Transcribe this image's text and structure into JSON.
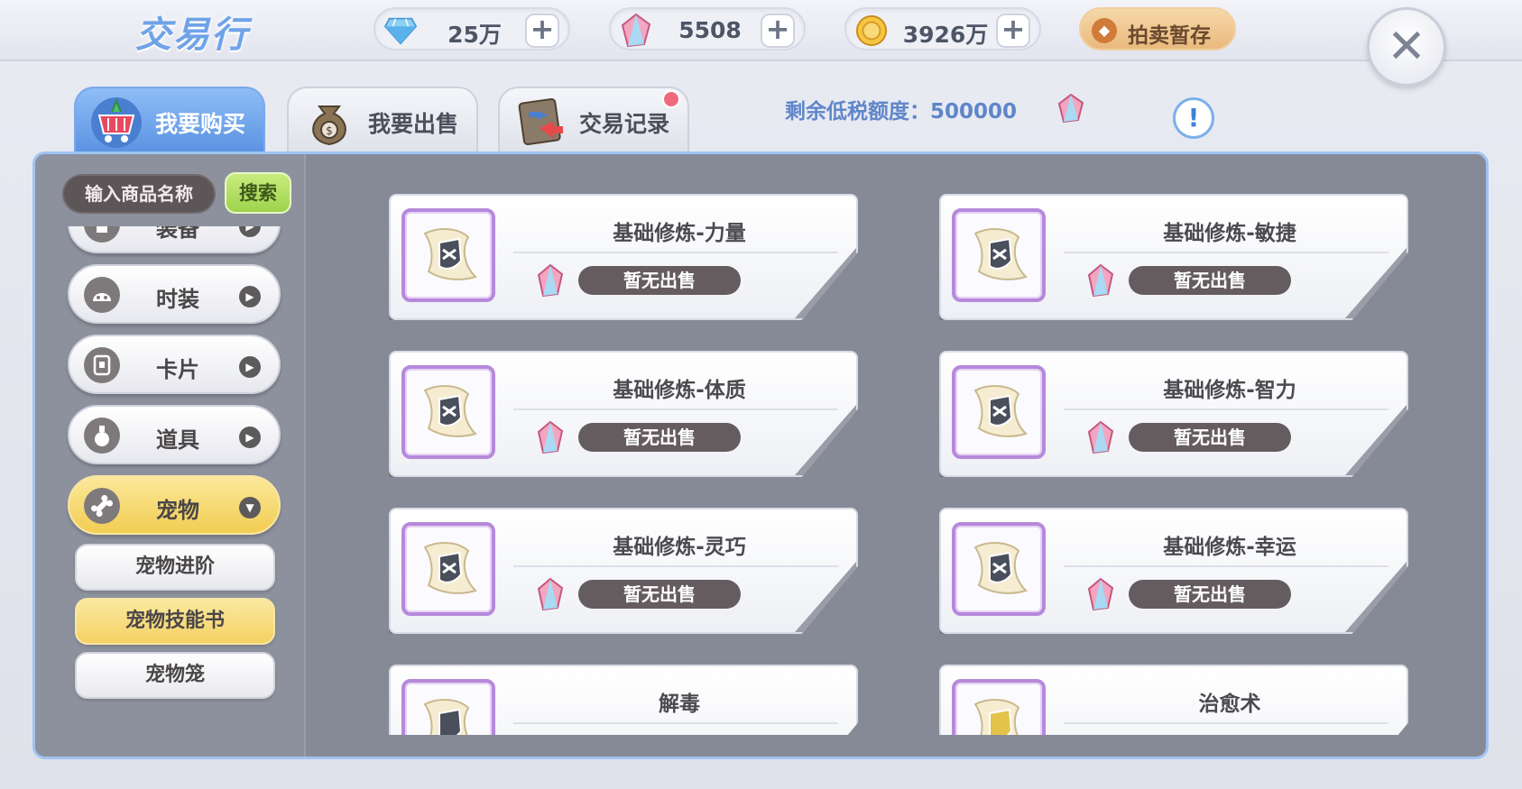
{
  "header": {
    "title": "交易行",
    "currencies": [
      {
        "icon": "diamond-icon",
        "value": "25万",
        "color": "#7ec3f0"
      },
      {
        "icon": "crystal-gem-icon",
        "value": "5508",
        "color": "#e88aa6"
      },
      {
        "icon": "gold-coin-icon",
        "value": "3926万",
        "color": "#f2b631"
      }
    ],
    "plus_label": "+",
    "auction_label": "拍卖暂存",
    "close_label": "✕"
  },
  "tabs": [
    {
      "label": "我要购买",
      "icon": "shopping-basket-icon",
      "active": true
    },
    {
      "label": "我要出售",
      "icon": "money-bag-icon",
      "active": false
    },
    {
      "label": "交易记录",
      "icon": "trade-record-icon",
      "active": false,
      "badge": true
    }
  ],
  "tax": {
    "label": "剩余低税额度：500000",
    "info_label": "!"
  },
  "search": {
    "placeholder": "输入商品名称",
    "button_label": "搜索"
  },
  "categories": [
    {
      "label": "装备",
      "icon": "shirt-icon"
    },
    {
      "label": "时装",
      "icon": "fashion-head-icon"
    },
    {
      "label": "卡片",
      "icon": "card-icon"
    },
    {
      "label": "道具",
      "icon": "potion-icon"
    },
    {
      "label": "宠物",
      "icon": "bone-icon",
      "active": true
    }
  ],
  "subcategories": [
    {
      "label": "宠物进阶",
      "active": false
    },
    {
      "label": "宠物技能书",
      "active": true
    },
    {
      "label": "宠物笼",
      "active": false
    }
  ],
  "items": [
    {
      "name": "基础修炼-力量",
      "status": "暂无出售"
    },
    {
      "name": "基础修炼-敏捷",
      "status": "暂无出售"
    },
    {
      "name": "基础修炼-体质",
      "status": "暂无出售"
    },
    {
      "name": "基础修炼-智力",
      "status": "暂无出售"
    },
    {
      "name": "基础修炼-灵巧",
      "status": "暂无出售"
    },
    {
      "name": "基础修炼-幸运",
      "status": "暂无出售"
    },
    {
      "name": "解毒",
      "status": ""
    },
    {
      "name": "治愈术",
      "status": ""
    }
  ]
}
